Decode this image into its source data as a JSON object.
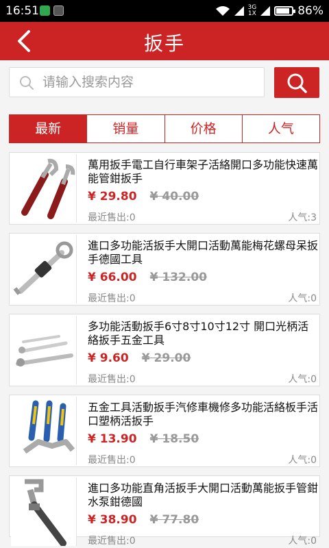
{
  "statusbar": {
    "time": "16:51",
    "network": "3G",
    "network_sub": "1X",
    "battery": "86%",
    "battery_level": 0.86
  },
  "header": {
    "title": "扳手"
  },
  "search": {
    "placeholder": "请输入搜索内容"
  },
  "tabs": [
    {
      "label": "最新",
      "active": true
    },
    {
      "label": "销量",
      "active": false
    },
    {
      "label": "价格",
      "active": false
    },
    {
      "label": "人气",
      "active": false
    }
  ],
  "products": [
    {
      "name": "萬用扳手電工自行車架子活絡開口多功能快速萬能管鉗扳手",
      "price": "¥ 29.80",
      "original_price": "¥ 40.00",
      "sold": "最近售出:0",
      "popularity": "人气:3"
    },
    {
      "name": "進口多功能活扳手大開口活動萬能梅花螺母呆扳手德國工具",
      "price": "¥ 66.00",
      "original_price": "¥ 132.00",
      "sold": "最近售出:0",
      "popularity": "人气:0"
    },
    {
      "name": "多功能活動扳手6寸8寸10寸12寸 開口光柄活絡扳手五金工具",
      "price": "¥ 9.60",
      "original_price": "¥ 29.00",
      "sold": "最近售出:0",
      "popularity": "人气:0"
    },
    {
      "name": "五金工具活動扳手汽修車機修多功能活絡板手活口塑柄活扳手",
      "price": "¥ 13.90",
      "original_price": "¥ 18.50",
      "sold": "最近售出:0",
      "popularity": "人气:0"
    },
    {
      "name": "進口多功能直角活扳手大開口活動萬能扳手管鉗水泵鉗德國",
      "price": "¥ 38.90",
      "original_price": "¥ 77.80",
      "sold": "最近售出:0",
      "popularity": "人气:0"
    }
  ],
  "colors": {
    "brand": "#cc2424",
    "price": "#cc2424",
    "muted": "#888888"
  }
}
